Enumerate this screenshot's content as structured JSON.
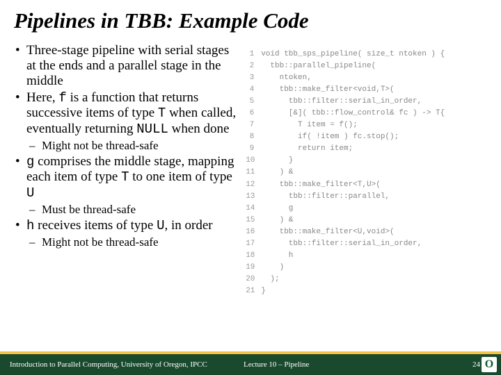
{
  "title": "Pipelines in TBB: Example Code",
  "bullets": {
    "b1": "Three-stage pipeline with serial stages at the ends and a parallel stage in the middle",
    "b2a": "Here, ",
    "b2b": " is a function that returns successive items of type ",
    "b2c": " when called, eventually returning ",
    "b2d": " when done",
    "b2f": "f",
    "b2T": "T",
    "b2N": "NULL",
    "s1": "Might not be thread-safe",
    "b3a": " comprises the middle stage, mapping each item of type ",
    "b3b": " to one item of type ",
    "b3g": "g",
    "b3T": "T",
    "b3U": "U",
    "s2": "Must be thread-safe",
    "b4a": " receives items of type ",
    "b4b": ", in order",
    "b4h": "h",
    "b4U": "U",
    "s3": "Might not be thread-safe"
  },
  "code": [
    "void tbb_sps_pipeline( size_t ntoken ) {",
    "  tbb::parallel_pipeline(",
    "    ntoken,",
    "    tbb::make_filter<void,T>(",
    "      tbb::filter::serial_in_order,",
    "      [&]( tbb::flow_control& fc ) -> T{",
    "        T item = f();",
    "        if( !item ) fc.stop();",
    "        return item;",
    "      }",
    "    ) &",
    "    tbb::make_filter<T,U>(",
    "      tbb::filter::parallel,",
    "      g",
    "    ) &",
    "    tbb::make_filter<U,void>(",
    "      tbb::filter::serial_in_order,",
    "      h",
    "    )",
    "  );",
    "}"
  ],
  "footer": {
    "left": "Introduction to Parallel Computing, University of Oregon, IPCC",
    "mid": "Lecture 10 – Pipeline",
    "page": "24"
  }
}
